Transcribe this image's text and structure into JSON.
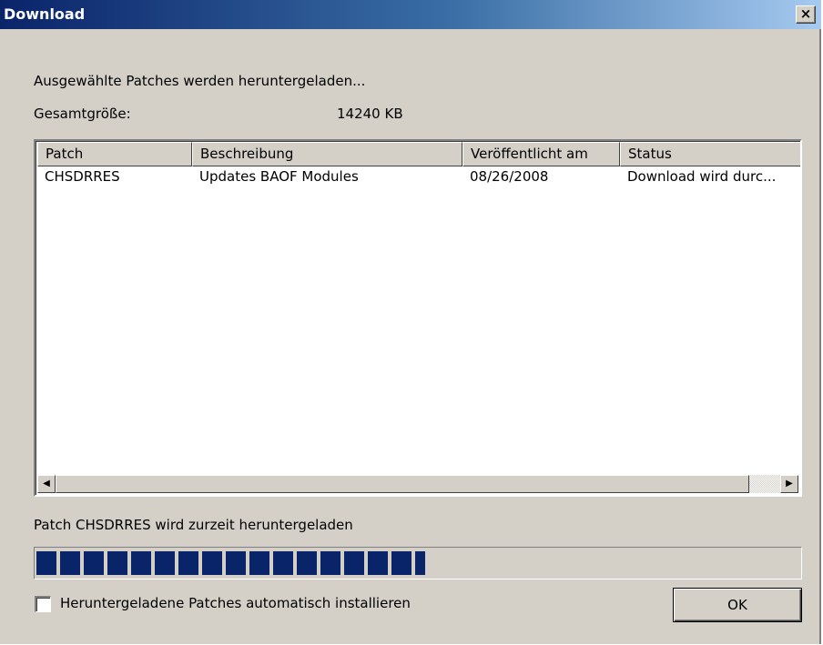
{
  "window": {
    "title": "Download",
    "close_glyph": "×",
    "close_icon": "close-icon"
  },
  "info": {
    "status_line": "Ausgewählte Patches werden heruntergeladen...",
    "total_label": "Gesamtgröße:",
    "total_value": "14240 KB"
  },
  "table": {
    "columns": [
      "Patch",
      "Beschreibung",
      "Veröffentlicht am",
      "Status"
    ],
    "rows": [
      [
        "CHSDRRES",
        "Updates BAOF Modules",
        "08/26/2008",
        "Download wird durc..."
      ]
    ],
    "scroll_left_glyph": "◀",
    "scroll_right_glyph": "▶"
  },
  "download": {
    "current_label": "Patch CHSDRRES wird zurzeit heruntergeladen",
    "progress_percent": 51,
    "accent_color": "#0a246a"
  },
  "footer": {
    "auto_install_label": "Heruntergeladene Patches automatisch installieren",
    "auto_install_checked": false,
    "ok_label": "OK"
  }
}
